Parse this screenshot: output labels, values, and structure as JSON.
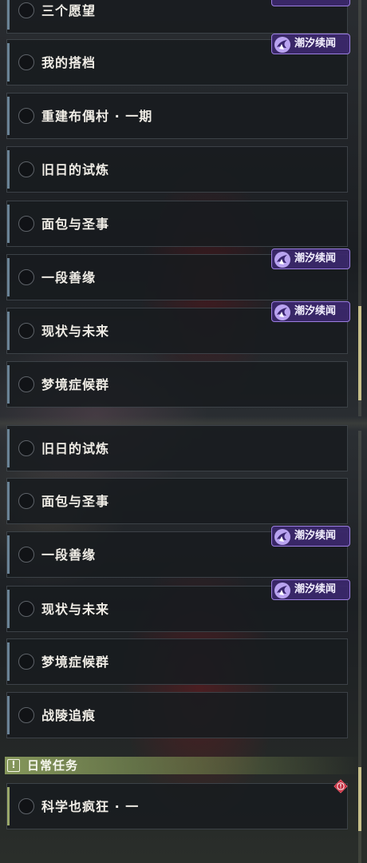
{
  "tag_label": "潮汐续闻",
  "panel_top": {
    "quests": [
      {
        "label": "三个愿望"
      },
      {
        "label": "我的搭档"
      },
      {
        "label": "重建布偶村 · 一期"
      },
      {
        "label": "旧日的试炼"
      },
      {
        "label": "面包与圣事"
      },
      {
        "label": "一段善缘"
      },
      {
        "label": "现状与未来"
      },
      {
        "label": "梦境症候群"
      }
    ]
  },
  "panel_bottom": {
    "quests": [
      {
        "label": "旧日的试炼"
      },
      {
        "label": "面包与圣事"
      },
      {
        "label": "一段善缘"
      },
      {
        "label": "现状与未来"
      },
      {
        "label": "梦境症候群"
      },
      {
        "label": "战陵追痕"
      }
    ],
    "daily_section": {
      "title": "日常任务",
      "quests": [
        {
          "label": "科学也疯狂 · 一"
        }
      ]
    }
  },
  "colors": {
    "tag_bg": "#3c286e",
    "tag_border": "#9b7de0",
    "daily_accent": "#9aa86a",
    "alert_red": "#c0283a",
    "scroll_thumb": "#c8c08a"
  },
  "icons": {
    "tag": "tide-wave-icon",
    "daily": "exclamation-box-icon",
    "alert": "alert-diamond-icon"
  }
}
